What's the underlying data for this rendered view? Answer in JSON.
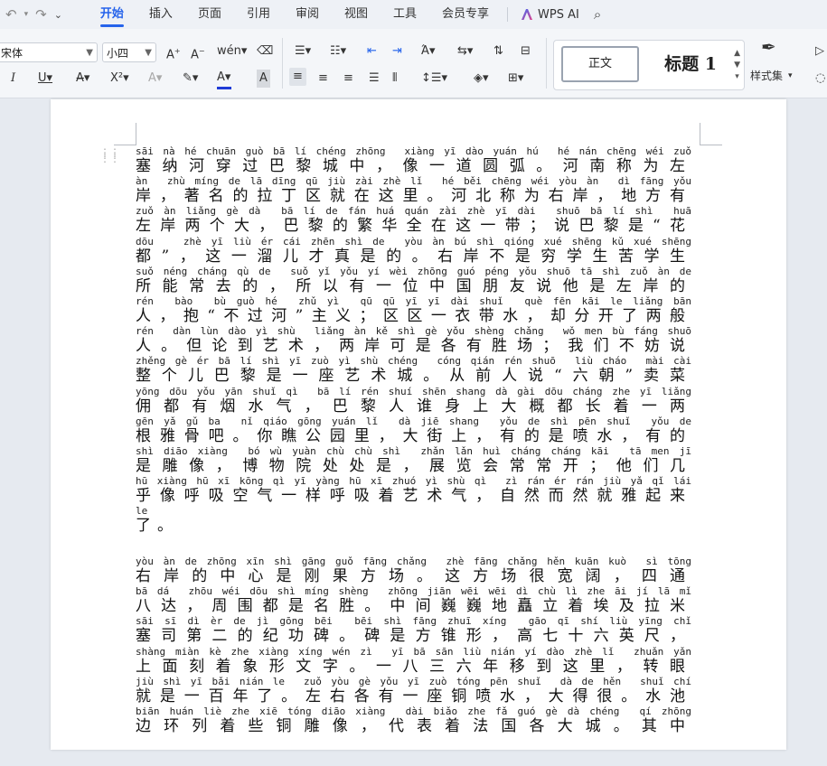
{
  "menu": {
    "tabs": [
      "开始",
      "插入",
      "页面",
      "引用",
      "审阅",
      "视图",
      "工具",
      "会员专享"
    ],
    "active_tab": "开始",
    "wps_ai": "WPS AI"
  },
  "ribbon": {
    "font_name": "宋体",
    "font_size": "小四",
    "styles": {
      "normal": "正文",
      "heading1": "标题 1",
      "gallery": "样式集"
    },
    "colors": {
      "font_color": "#1f3bd6",
      "accent": "#2563eb"
    }
  },
  "document": {
    "paragraph1": [
      {
        "py": "sāi nà hé chuān guò bā lí chéng zhōng  xiàng yī dào yuán hú  hé nán chēng wéi zuǒ",
        "hz": "塞纳河穿过巴黎城中，像一道圆弧。河南称为左"
      },
      {
        "py": "àn  zhù míng de lā dīng qū jiù zài zhè lǐ  hé běi chēng wéi yòu àn  dì fāng yǒu",
        "hz": "岸，著名的拉丁区就在这里。河北称为右岸，地方有"
      },
      {
        "py": "zuǒ àn liǎng gè dà  bā lí de fán huá quán zài zhè yī dài  shuō bā lí shì  huā",
        "hz": "左岸两个大，巴黎的繁华全在这一带；说巴黎是“花"
      },
      {
        "py": "dōu   zhè yī liù ér cái zhēn shì de  yòu àn bú shì qióng xué shēng kǔ xué shēng",
        "hz": "都”，这一溜儿才真是的。右岸不是穷学生苦学生"
      },
      {
        "py": "suǒ néng cháng qù de  suǒ yǐ yǒu yí wèi zhōng guó péng yǒu shuō tā shì zuǒ àn de",
        "hz": "所能常去的，所以有一位中国朋友说他是左岸的"
      },
      {
        "py": "rén  bào  bù guò hé  zhǔ yì  qū qū yī yī dài shuǐ  què fēn kāi le liǎng bān",
        "hz": "人，抱“不过河”主义；区区一衣带水，却分开了两般"
      },
      {
        "py": "rén  dàn lùn dào yì shù  liǎng àn kě shì gè yǒu shèng chǎng  wǒ men bù fáng shuō",
        "hz": "人。但论到艺术，两岸可是各有胜场；我们不妨说"
      },
      {
        "py": "zhěng gè ér bā lí shì yī zuò yì shù chéng  cóng qián rén shuō  liù cháo  mài cài",
        "hz": "整个儿巴黎是一座艺术城。从前人说“六朝”卖菜"
      },
      {
        "py": "yōng dōu yǒu yān shuǐ qì  bā lí rén shuí shēn shang dà gài dōu cháng zhe yī liǎng",
        "hz": "佣都有烟水气，巴黎人谁身上大概都长着一两"
      },
      {
        "py": "gēn yǎ gǔ ba  nǐ qiáo gōng yuán lǐ  dà jiē shang  yǒu de shì pēn shuǐ  yǒu de",
        "hz": "根雅骨吧。你瞧公园里，大街上，有的是喷水，有的"
      },
      {
        "py": "shì diāo xiàng  bó wù yuàn chù chù shì  zhǎn lǎn huì cháng cháng kāi  tā men jī",
        "hz": "是雕像，博物院处处是，展览会常常开；他们几"
      },
      {
        "py": "hū xiàng hū xī kōng qì yī yàng hū xī zhuó yì shù qì  zì rán ér rán jiù yǎ qǐ lái",
        "hz": "乎像呼吸空气一样呼吸着艺术气，自然而然就雅起来"
      },
      {
        "py": "le",
        "hz": "了。"
      }
    ],
    "paragraph2": [
      {
        "py": "yòu àn de zhōng xīn shì gāng guǒ fāng chǎng  zhè fāng chǎng hěn kuān kuò  sì tōng",
        "hz": "右岸的中心是刚果方场。这方场很宽阔，四通"
      },
      {
        "py": "bā dá  zhōu wéi dōu shì míng shèng  zhōng jiān wēi wēi dì chù lì zhe āi jí lā mǐ",
        "hz": "八达，周围都是名胜。中间巍巍地矗立着埃及拉米"
      },
      {
        "py": "sāi sī dì èr de jì gōng bēi  bēi shì fāng zhuī xíng  gāo qī shí liù yīng chǐ",
        "hz": "塞司第二的纪功碑。碑是方锥形，高七十六英尺，"
      },
      {
        "py": "shàng miàn kè zhe xiàng xíng wén zì  yī bā sān liù nián yí dào zhè lǐ  zhuǎn yǎn",
        "hz": "上面刻着象形文字。一八三六年移到这里，转眼"
      },
      {
        "py": "jiù shì yī bǎi nián le  zuǒ yòu gè yǒu yī zuò tóng pēn shuǐ  dà de hěn  shuǐ chí",
        "hz": "就是一百年了。左右各有一座铜喷水，大得很。水池"
      },
      {
        "py": "biān huán liè zhe xiē tóng diāo xiàng  dài biǎo zhe fǎ guó gè dà chéng  qí zhōng",
        "hz": "边环列着些铜雕像，代表着法国各大城。其中"
      },
      {
        "py": "",
        "hz": ""
      }
    ]
  }
}
